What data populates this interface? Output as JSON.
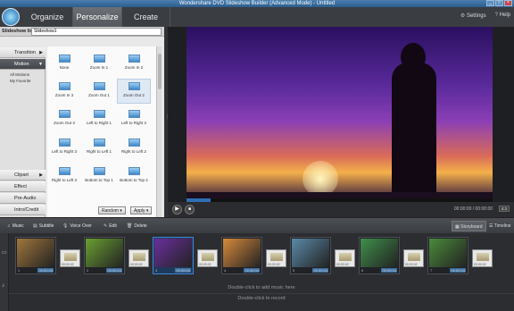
{
  "window": {
    "title": "Wondershare DVD Slideshow Builder (Advanced Mode) - Untitled",
    "controls": [
      "_",
      "□",
      "×"
    ]
  },
  "topbar": {
    "tabs": [
      {
        "label": "Organize"
      },
      {
        "label": "Personalize"
      },
      {
        "label": "Create"
      }
    ],
    "settings_label": "Settings",
    "help_label": "Help"
  },
  "slideshow_list": {
    "label": "Slideshow list :",
    "value": "Slideshow1"
  },
  "categories": [
    {
      "label": "Transition"
    },
    {
      "label": "Motion"
    },
    {
      "label": "Clipart"
    },
    {
      "label": "Effect"
    },
    {
      "label": "Pre-Audio"
    },
    {
      "label": "Intro/Credit"
    }
  ],
  "motion_sub": [
    "All Motions",
    "My Favorite"
  ],
  "motions": [
    "None",
    "Zoom In 1",
    "Zoom In 2",
    "Zoom In 3",
    "Zoom Out 1",
    "Zoom Out 2",
    "Zoom Out 3",
    "Left to Right 1",
    "Left to Right 2",
    "Left to Right 3",
    "Right to Left 1",
    "Right to Left 2",
    "Right to Left 3",
    "Bottom to Top 1",
    "Bottom to Top 2"
  ],
  "grid_buttons": {
    "random": "Random",
    "apply": "Apply"
  },
  "player": {
    "timecode": "00:00:00 / 00:00:00",
    "ratio": "4:3",
    "progress_fraction": 0.08
  },
  "timeline_toolbar": {
    "music": "Music",
    "subtitle": "Subtitle",
    "voice_over": "Voice Over",
    "edit": "Edit",
    "delete": "Delete",
    "storyboard": "Storyboard",
    "timeline": "Timeline"
  },
  "clips": [
    {
      "num": "1",
      "dur": "00:00:04",
      "color": "#a0763c"
    },
    {
      "num": "2",
      "dur": "00:00:04",
      "color": "#6aa032"
    },
    {
      "num": "3",
      "dur": "00:00:04",
      "color": "#6a2f9e"
    },
    {
      "num": "4",
      "dur": "00:00:04",
      "color": "#d88a3c"
    },
    {
      "num": "5",
      "dur": "00:00:04",
      "color": "#5b8aa8"
    },
    {
      "num": "6",
      "dur": "00:00:04",
      "color": "#3f8f4a"
    },
    {
      "num": "7",
      "dur": "00:00:04",
      "color": "#4c8a3a"
    }
  ],
  "transitions": [
    {
      "dur": "00:00:02"
    },
    {
      "dur": "00:00:02"
    },
    {
      "dur": "00:00:02"
    },
    {
      "dur": "00:00:02"
    },
    {
      "dur": "00:00:02"
    },
    {
      "dur": "00:00:02"
    },
    {
      "dur": "00:00:02"
    }
  ],
  "audio_hints": {
    "music": "Double-click to add music here",
    "record": "Double-click to record"
  }
}
